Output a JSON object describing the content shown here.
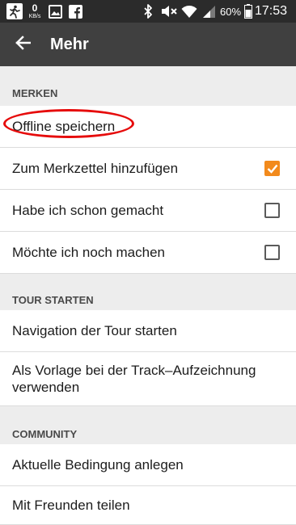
{
  "status_bar": {
    "net_speed_value": "0",
    "net_speed_unit": "KB/s",
    "battery_percent": "60%",
    "time": "17:53",
    "icons": [
      "running-person-icon",
      "image-icon",
      "facebook-icon",
      "bluetooth-icon",
      "mute-icon",
      "wifi-icon",
      "signal-icon",
      "battery-icon"
    ]
  },
  "app_bar": {
    "back_icon": "arrow-left-icon",
    "title": "Mehr"
  },
  "sections": {
    "merken": {
      "header": "MERKEN",
      "items": [
        {
          "label": "Offline speichern",
          "annotation": "red-ellipse-highlight"
        },
        {
          "label": "Zum Merkzettel hinzufügen",
          "checked": true
        },
        {
          "label": "Habe ich schon gemacht",
          "checked": false
        },
        {
          "label": "Möchte ich noch machen",
          "checked": false
        }
      ]
    },
    "tour_starten": {
      "header": "TOUR STARTEN",
      "items": [
        {
          "label": "Navigation der Tour starten"
        },
        {
          "label": "Als Vorlage bei der Track–Aufzeichnung verwenden"
        }
      ]
    },
    "community": {
      "header": "COMMUNITY",
      "items": [
        {
          "label": "Aktuelle Bedingung anlegen"
        },
        {
          "label": "Mit Freunden teilen"
        }
      ]
    }
  },
  "colors": {
    "status_bar": "#2b2b2b",
    "app_bar": "#404040",
    "background": "#ededed",
    "accent_orange": "#f28a1c",
    "annotation_red": "#e60b0b"
  }
}
